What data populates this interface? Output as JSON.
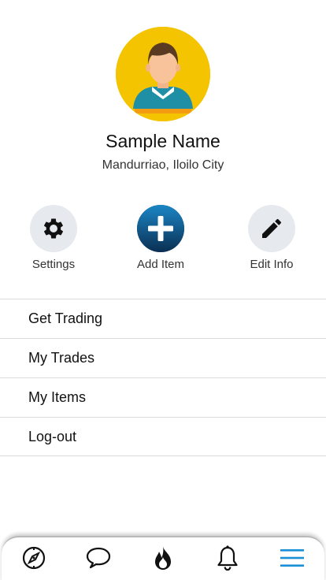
{
  "profile": {
    "name": "Sample Name",
    "location": "Mandurriao, Iloilo City"
  },
  "actions": [
    {
      "label": "Settings",
      "icon": "gear-icon"
    },
    {
      "label": "Add Item",
      "icon": "plus-icon"
    },
    {
      "label": "Edit Info",
      "icon": "pencil-icon"
    }
  ],
  "menu": [
    {
      "label": "Get Trading"
    },
    {
      "label": "My Trades"
    },
    {
      "label": "My Items"
    },
    {
      "label": "Log-out"
    }
  ],
  "bottom_nav": [
    {
      "icon": "compass-icon",
      "active": false
    },
    {
      "icon": "chat-bubble-icon",
      "active": false
    },
    {
      "icon": "flame-icon",
      "active": false
    },
    {
      "icon": "bell-icon",
      "active": false
    },
    {
      "icon": "menu-icon",
      "active": true
    }
  ],
  "colors": {
    "avatar_bg": "#f5c400",
    "primary": "#0d3c63",
    "active_nav": "#1a8fd6",
    "icon_bg": "#e6e9ee"
  }
}
